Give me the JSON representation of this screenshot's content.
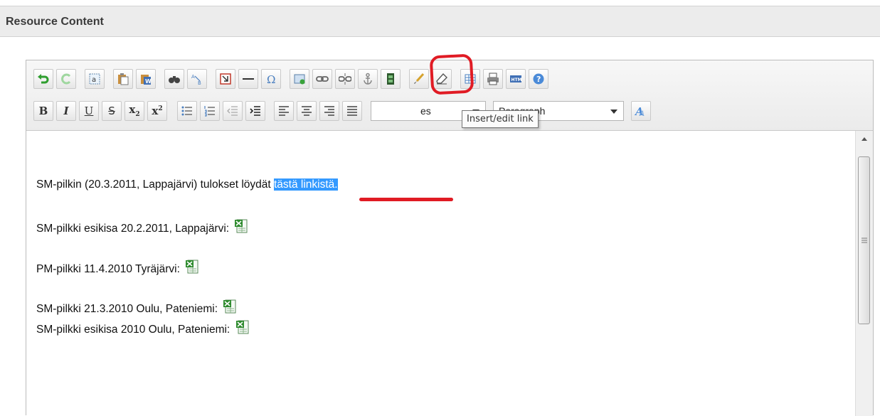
{
  "section": {
    "title": "Resource Content"
  },
  "toolbar": {
    "row1": [
      {
        "name": "undo-button",
        "icon": "undo-icon"
      },
      {
        "name": "redo-button",
        "icon": "redo-icon"
      },
      {
        "name": "select-all-button",
        "icon": "select-all-icon"
      },
      {
        "name": "paste-text-button",
        "icon": "paste-text-icon"
      },
      {
        "name": "paste-word-button",
        "icon": "paste-word-icon"
      },
      {
        "name": "find-button",
        "icon": "binoculars-icon"
      },
      {
        "name": "replace-button",
        "icon": "replace-icon"
      },
      {
        "name": "insert-template-button",
        "icon": "template-icon"
      },
      {
        "name": "horizontal-rule-button",
        "icon": "horizontal-rule-icon"
      },
      {
        "name": "special-char-button",
        "icon": "omega-icon"
      },
      {
        "name": "insert-image-button",
        "icon": "image-icon"
      },
      {
        "name": "insert-link-button",
        "icon": "link-icon"
      },
      {
        "name": "unlink-button",
        "icon": "unlink-icon"
      },
      {
        "name": "anchor-button",
        "icon": "anchor-icon"
      },
      {
        "name": "insert-media-button",
        "icon": "film-icon"
      },
      {
        "name": "cleanup-button",
        "icon": "brush-icon"
      },
      {
        "name": "remove-format-button",
        "icon": "eraser-icon"
      },
      {
        "name": "table-button",
        "icon": "table-icon"
      },
      {
        "name": "print-button",
        "icon": "printer-icon"
      },
      {
        "name": "html-source-button",
        "icon": "html-icon"
      },
      {
        "name": "help-button",
        "icon": "help-icon"
      }
    ],
    "row2_glyphs": {
      "bold": "B",
      "italic": "I",
      "underline": "U",
      "strike": "S",
      "sub_x": "x",
      "sub_n": "2",
      "sup_x": "x",
      "sup_n": "2"
    },
    "styles_select": {
      "value": "es"
    },
    "format_select": {
      "value": "Paragraph"
    }
  },
  "tooltip": {
    "text": "Insert/edit link"
  },
  "content": {
    "line1_prefix": "SM-pilkin (20.3.2011, Lappajärvi) tulokset löydät ",
    "line1_link": "tästä linkistä.",
    "line2": "SM-pilkki esikisa 20.2.2011, Lappajärvi:",
    "line3": "PM-pilkki 11.4.2010 Tyräjärvi:",
    "line4": "SM-pilkki 21.3.2010 Oulu, Pateniemi:",
    "line5": "SM-pilkki esikisa 2010 Oulu, Pateniemi:"
  },
  "colors": {
    "selection": "#3399ff",
    "annotation_red": "#e01b24",
    "excel_green": "#2e8b2e"
  }
}
